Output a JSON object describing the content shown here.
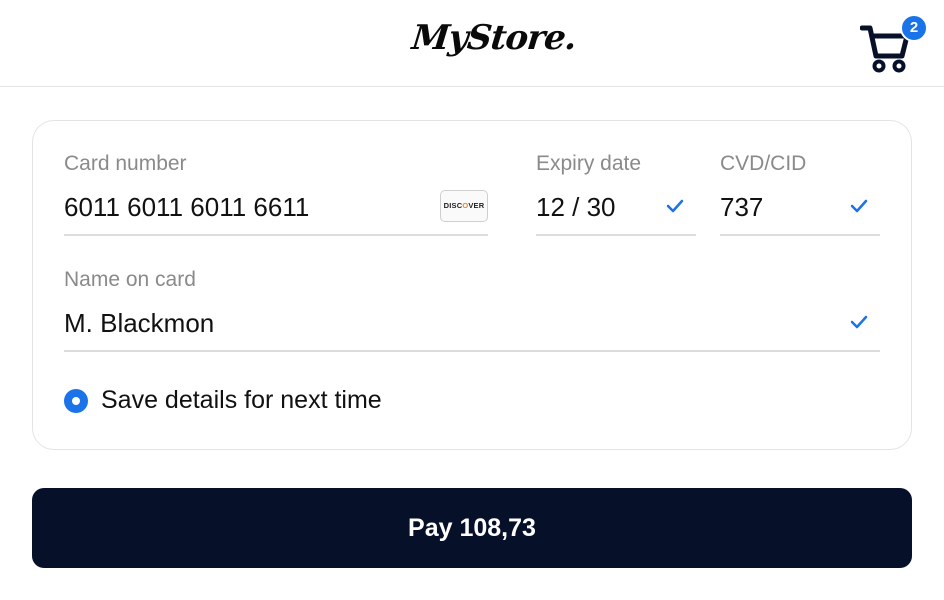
{
  "header": {
    "logo_text": "MyStore.",
    "cart_icon": "shopping-cart-icon",
    "cart_count": "2"
  },
  "form": {
    "card_number": {
      "label": "Card number",
      "value": "6011 6011 6011 6611",
      "brand_logo": "DISCOVER"
    },
    "expiry": {
      "label": "Expiry date",
      "value": "12 / 30",
      "valid": true
    },
    "cvd": {
      "label": "CVD/CID",
      "value": "737",
      "valid": true
    },
    "name": {
      "label": "Name on card",
      "value": "M. Blackmon",
      "valid": true
    },
    "save_details": {
      "label": "Save details for next time",
      "selected": true
    }
  },
  "pay_button": {
    "label": "Pay 108,73"
  },
  "colors": {
    "accent": "#1a73e8",
    "pay_button_bg": "#061028",
    "discover_orange": "#f48120"
  }
}
